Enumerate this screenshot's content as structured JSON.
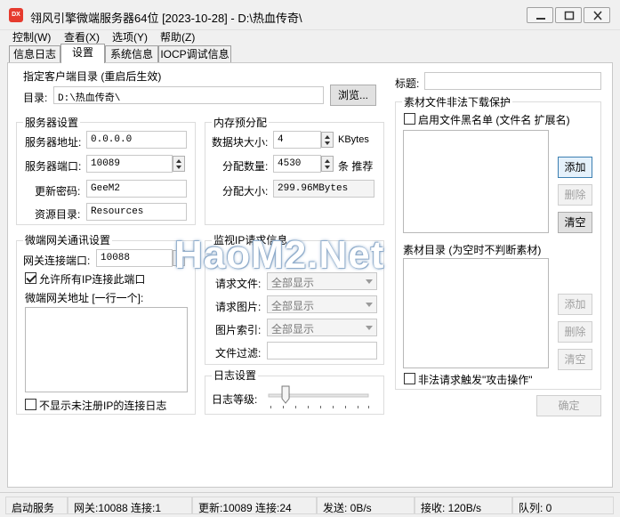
{
  "window": {
    "title": "翎风引擎微端服务器64位 [2023-10-28] - D:\\热血传奇\\",
    "app_icon_text": "DX"
  },
  "menu": [
    "控制(W)",
    "查看(X)",
    "选项(Y)",
    "帮助(Z)"
  ],
  "tabs": [
    "信息日志",
    "设置",
    "系统信息",
    "IOCP调试信息"
  ],
  "client_dir": {
    "title": "指定客户端目录 (重启后生效)",
    "label": "目录:",
    "value": "D:\\热血传奇\\",
    "browse_label": "浏览..."
  },
  "server": {
    "title": "服务器设置",
    "addr_label": "服务器地址:",
    "addr_value": "0.0.0.0",
    "port_label": "服务器端口:",
    "port_value": "10089",
    "pwd_label": "更新密码:",
    "pwd_value": "GeeM2",
    "res_label": "资源目录:",
    "res_value": "Resources"
  },
  "memory": {
    "title": "内存预分配",
    "block_label": "数据块大小:",
    "block_value": "4",
    "block_unit": "KBytes",
    "count_label": "分配数量:",
    "count_value": "4530",
    "count_unit": "条 推荐",
    "size_label": "分配大小:",
    "size_value": "299.96MBytes"
  },
  "title_field": {
    "label": "标题:",
    "value": ""
  },
  "protect": {
    "title": "素材文件非法下载保护",
    "blacklist_label": "启用文件黑名单 (文件名 扩展名)",
    "add_label": "添加",
    "delete_label": "删除",
    "clear_label": "清空",
    "whitelist_title": "素材目录 (为空时不判断素材)",
    "attack_label": "非法请求触发\"攻击操作\""
  },
  "gateway": {
    "title": "微端网关通讯设置",
    "port_label": "网关连接端口:",
    "port_value": "10088",
    "allow_label": "允许所有IP连接此端口",
    "addr_label": "微端网关地址 [一行一个]:",
    "hide_log_label": "不显示未注册IP的连接日志"
  },
  "monitor": {
    "title": "监视IP请求信息",
    "rows": [
      {
        "label": "请求文件:",
        "value": "全部显示"
      },
      {
        "label": "请求图片:",
        "value": "全部显示"
      },
      {
        "label": "图片索引:",
        "value": "全部显示"
      }
    ],
    "filter_label": "文件过滤:",
    "filter_value": ""
  },
  "log": {
    "title": "日志设置",
    "level_label": "日志等级:",
    "level_value": 0.17
  },
  "ok_label": "确定",
  "watermark": "HaoM2.Net",
  "status": {
    "service": "启动服务",
    "gateway": "网关:10088  连接:1",
    "update": "更新:10089  连接:24",
    "send": "发送: 0B/s",
    "recv": "接收: 120B/s",
    "queue": "队列: 0"
  }
}
